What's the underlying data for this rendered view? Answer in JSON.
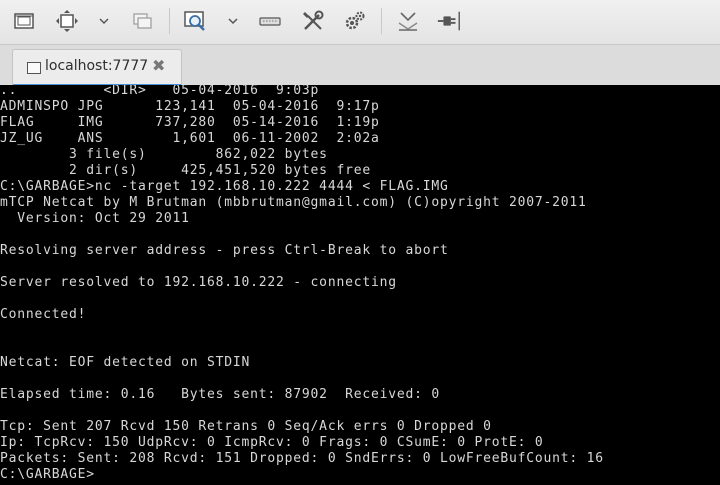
{
  "toolbar": {
    "buttons": [
      {
        "name": "screen-icon"
      },
      {
        "name": "fit-window-icon"
      },
      {
        "name": "chevron-down-icon"
      },
      {
        "name": "windows-icon"
      },
      {
        "name": "zoom-icon"
      },
      {
        "name": "chevron-down-icon"
      },
      {
        "name": "keyboard-icon"
      },
      {
        "name": "tools-icon"
      },
      {
        "name": "settings-icon"
      },
      {
        "name": "download-icon"
      },
      {
        "name": "disconnect-icon"
      }
    ]
  },
  "tab": {
    "label": "localhost:7777",
    "close": "✖"
  },
  "terminal": {
    "lines": [
      "..          <DIR>   05-04-2016  9:03p",
      "ADMINSPO JPG      123,141  05-04-2016  9:17p",
      "FLAG     IMG      737,280  05-14-2016  1:19p",
      "JZ_UG    ANS        1,601  06-11-2002  2:02a",
      "        3 file(s)        862,022 bytes",
      "        2 dir(s)     425,451,520 bytes free",
      "C:\\GARBAGE>nc -target 192.168.10.222 4444 < FLAG.IMG",
      "mTCP Netcat by M Brutman (mbbrutman@gmail.com) (C)opyright 2007-2011",
      "  Version: Oct 29 2011",
      "",
      "Resolving server address - press Ctrl-Break to abort",
      "",
      "Server resolved to 192.168.10.222 - connecting",
      "",
      "Connected!",
      "",
      "",
      "Netcat: EOF detected on STDIN",
      "",
      "Elapsed time: 0.16   Bytes sent: 87902  Received: 0",
      "",
      "Tcp: Sent 207 Rcvd 150 Retrans 0 Seq/Ack errs 0 Dropped 0",
      "Ip: TcpRcv: 150 UdpRcv: 0 IcmpRcv: 0 Frags: 0 CSumE: 0 ProtE: 0",
      "Packets: Sent: 208 Rcvd: 151 Dropped: 0 SndErrs: 0 LowFreeBufCount: 16",
      "C:\\GARBAGE>"
    ]
  }
}
